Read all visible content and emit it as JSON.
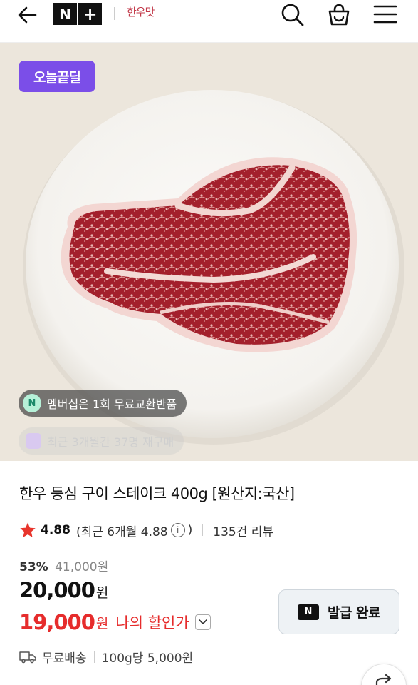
{
  "header": {
    "logo_letter": "N",
    "logo_plus": "+",
    "brand_name": "한우맛",
    "icons": [
      "back-arrow-icon",
      "search-icon",
      "shopping-bag-icon",
      "menu-icon"
    ]
  },
  "hero": {
    "deal_badge": "오늘끝딜",
    "membership_pill": "멤버십은 1회 무료교환반품",
    "membership_icon_letter": "N",
    "rebuy_pill": "최근 3개월간 37명 재구매"
  },
  "product": {
    "title": "한우 등심 구이 스테이크 400g [원산지:국산]",
    "rating_score": "4.88",
    "rating_recent_prefix": "(최근 6개월 4.88",
    "rating_info": "i",
    "rating_recent_suffix": ")",
    "review_count": "135건 리뷰",
    "discount_rate": "53%",
    "original_price": "41,000원",
    "price_number": "20,000",
    "price_unit": "원",
    "my_price_number": "19,000",
    "my_price_unit": "원",
    "my_price_label": "나의 할인가",
    "shipping": "무료배송",
    "unit_price": "100g당 5,000원"
  },
  "coupon": {
    "logo_letter": "N",
    "label": "발급 완료"
  },
  "colors": {
    "deal_badge": "#7b4ee8",
    "my_price": "#e62c2c",
    "star": "#e8352c"
  }
}
